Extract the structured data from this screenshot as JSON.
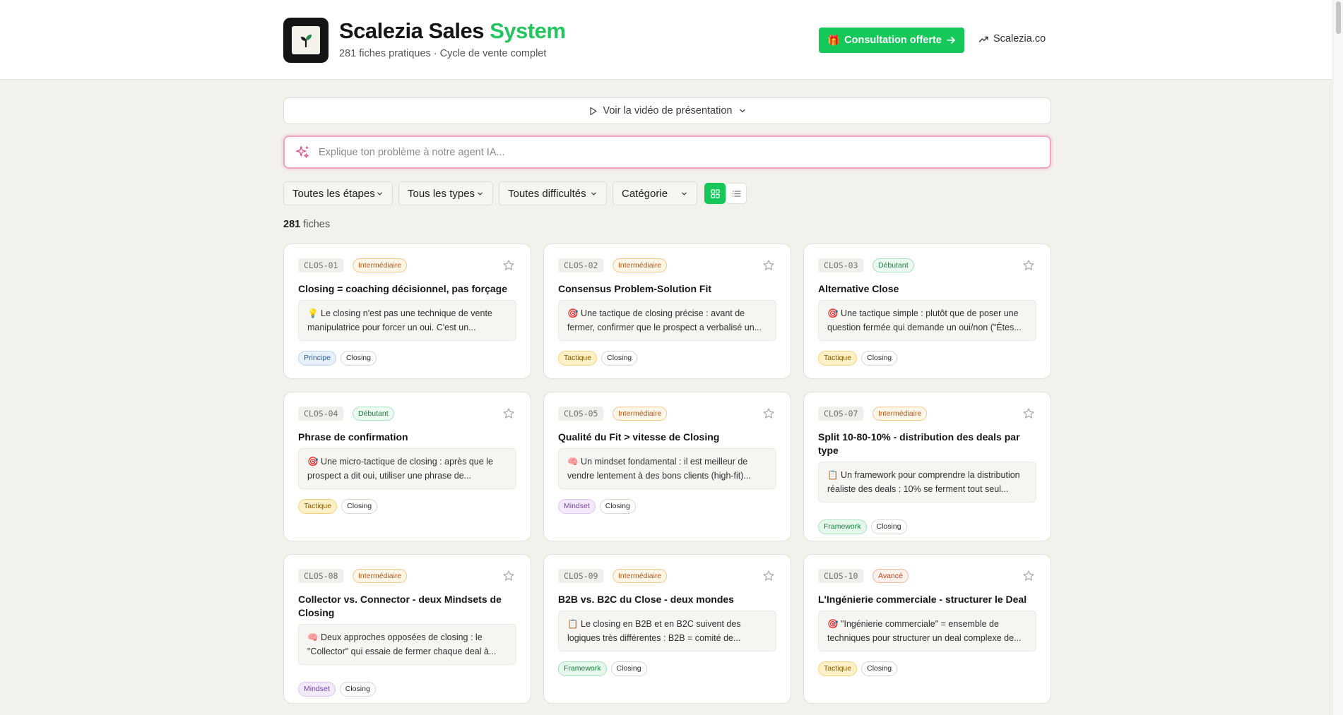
{
  "header": {
    "title_main": "Scalezia Sales",
    "title_accent": "System",
    "subtitle": "281 fiches pratiques · Cycle de vente complet",
    "cta_label": "Consultation offerte",
    "cta_emoji": "🎁",
    "site_link": "Scalezia.co"
  },
  "video": {
    "label": "Voir la vidéo de présentation"
  },
  "ai_search": {
    "placeholder": "Explique ton problème à notre agent IA..."
  },
  "filters": {
    "stage": "Toutes les étapes",
    "type": "Tous les types",
    "difficulty": "Toutes difficultés",
    "category": "Catégorie"
  },
  "count": {
    "number": "281",
    "label": "fiches"
  },
  "colors": {
    "accent": "#22c55e",
    "cta": "#16c75a",
    "ai_border": "#f3a2c4"
  },
  "cards": [
    {
      "code": "CLOS-01",
      "level": "Intermédiaire",
      "level_kind": "inter",
      "title": "Closing = coaching décisionnel, pas forçage",
      "desc": "💡 Le closing n'est pas une technique de vente manipulatrice pour forcer un oui. C'est un...",
      "type_tag": "Principe",
      "type_kind": "principe",
      "category": "Closing"
    },
    {
      "code": "CLOS-02",
      "level": "Intermédiaire",
      "level_kind": "inter",
      "title": "Consensus Problem-Solution Fit",
      "desc": "🎯 Une tactique de closing précise : avant de fermer, confirmer que le prospect a verbalisé un...",
      "type_tag": "Tactique",
      "type_kind": "tactique",
      "category": "Closing"
    },
    {
      "code": "CLOS-03",
      "level": "Débutant",
      "level_kind": "debut",
      "title": "Alternative Close",
      "desc": "🎯 Une tactique simple : plutôt que de poser une question fermée qui demande un oui/non (\"Êtes...",
      "type_tag": "Tactique",
      "type_kind": "tactique",
      "category": "Closing"
    },
    {
      "code": "CLOS-04",
      "level": "Débutant",
      "level_kind": "debut",
      "title": "Phrase de confirmation",
      "desc": "🎯 Une micro-tactique de closing : après que le prospect a dit oui, utiliser une phrase de...",
      "type_tag": "Tactique",
      "type_kind": "tactique",
      "category": "Closing"
    },
    {
      "code": "CLOS-05",
      "level": "Intermédiaire",
      "level_kind": "inter",
      "title": "Qualité du Fit > vitesse de Closing",
      "desc": "🧠 Un mindset fondamental : il est meilleur de vendre lentement à des bons clients (high-fit)...",
      "type_tag": "Mindset",
      "type_kind": "mindset",
      "category": "Closing"
    },
    {
      "code": "CLOS-07",
      "level": "Intermédiaire",
      "level_kind": "inter",
      "title": "Split 10-80-10% - distribution des deals par type",
      "desc": "📋 Un framework pour comprendre la distribution réaliste des deals : 10% se ferment tout seul...",
      "type_tag": "Framework",
      "type_kind": "framework",
      "category": "Closing"
    },
    {
      "code": "CLOS-08",
      "level": "Intermédiaire",
      "level_kind": "inter",
      "title": "Collector vs. Connector - deux Mindsets de Closing",
      "desc": "🧠 Deux approches opposées de closing : le \"Collector\" qui essaie de fermer chaque deal à...",
      "type_tag": "Mindset",
      "type_kind": "mindset",
      "category": "Closing"
    },
    {
      "code": "CLOS-09",
      "level": "Intermédiaire",
      "level_kind": "inter",
      "title": "B2B vs. B2C du Close - deux mondes",
      "desc": "📋 Le closing en B2B et en B2C suivent des logiques très différentes : B2B = comité de...",
      "type_tag": "Framework",
      "type_kind": "framework",
      "category": "Closing"
    },
    {
      "code": "CLOS-10",
      "level": "Avancé",
      "level_kind": "avance",
      "title": "L'Ingénierie commerciale - structurer le Deal",
      "desc": "🎯 \"Ingénierie commerciale\" = ensemble de techniques pour structurer un deal complexe de...",
      "type_tag": "Tactique",
      "type_kind": "tactique",
      "category": "Closing"
    }
  ]
}
